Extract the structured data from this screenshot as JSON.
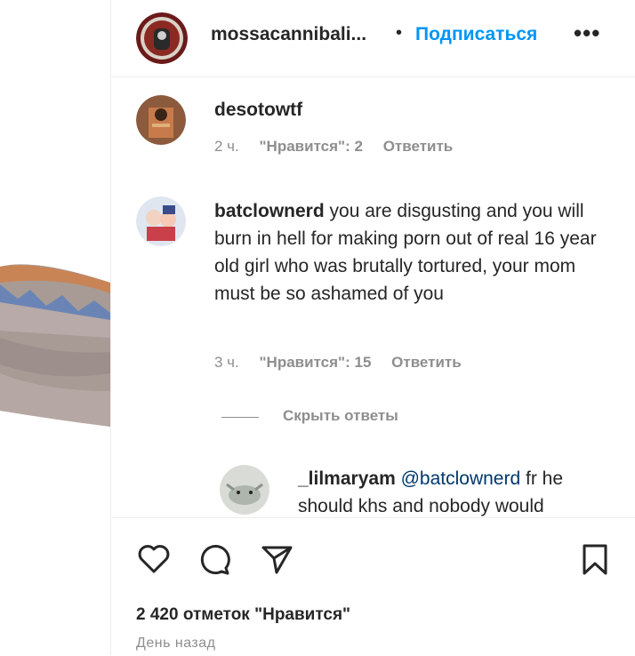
{
  "header": {
    "username": "mossacannibali...",
    "separator": "•",
    "follow_label": "Подписаться",
    "more_label": "•••"
  },
  "comments": [
    {
      "username": "desotowtf",
      "text": "",
      "time": "2 ч.",
      "likes": "\"Нравится\": 2",
      "reply_label": "Ответить"
    },
    {
      "username": "batclownerd",
      "text": "you are disgusting and you will burn in hell for making porn out of real 16 year old girl who was brutally tortured, your mom must be so ashamed of you",
      "time": "3 ч.",
      "likes": "\"Нравится\": 15",
      "reply_label": "Ответить"
    }
  ],
  "hide_replies_label": "Скрыть ответы",
  "reply": {
    "username": "_lilmaryam",
    "mention": "@batclownerd",
    "text": "fr he should khs and nobody would"
  },
  "actions": {
    "icons": [
      "heart-icon",
      "comment-icon",
      "share-icon",
      "bookmark-icon"
    ]
  },
  "likes_count": "2 420 отметок \"Нравится\"",
  "posted": "День назад",
  "colors": {
    "link_blue": "#0095f6",
    "mention_blue": "#00376b",
    "secondary_text": "#8e8e8e",
    "primary_text": "#262626"
  }
}
